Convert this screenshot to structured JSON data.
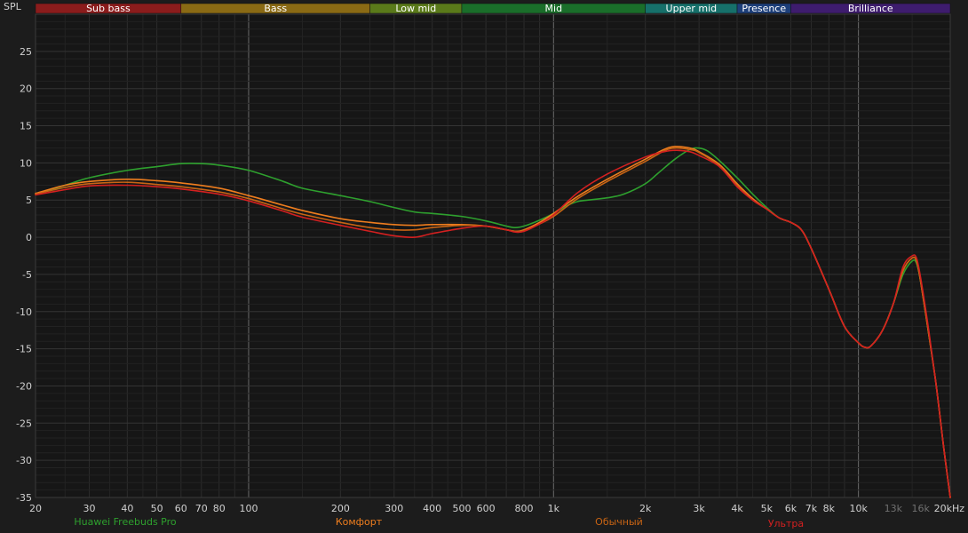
{
  "chart_data": {
    "type": "line",
    "ylabel": "SPL",
    "xscale": "log",
    "xlim": [
      20,
      20000
    ],
    "ylim": [
      -35,
      30
    ],
    "grid": true,
    "y_ticks": [
      25,
      20,
      15,
      10,
      5,
      0,
      -5,
      -10,
      -15,
      -20,
      -25,
      -30,
      -35
    ],
    "x_ticks": [
      {
        "v": 20,
        "label": "20",
        "dim": false
      },
      {
        "v": 30,
        "label": "30",
        "dim": false
      },
      {
        "v": 40,
        "label": "40",
        "dim": false
      },
      {
        "v": 50,
        "label": "50",
        "dim": false
      },
      {
        "v": 60,
        "label": "60",
        "dim": false
      },
      {
        "v": 70,
        "label": "70",
        "dim": false
      },
      {
        "v": 80,
        "label": "80",
        "dim": false
      },
      {
        "v": 100,
        "label": "100",
        "dim": false
      },
      {
        "v": 200,
        "label": "200",
        "dim": false
      },
      {
        "v": 300,
        "label": "300",
        "dim": false
      },
      {
        "v": 400,
        "label": "400",
        "dim": false
      },
      {
        "v": 500,
        "label": "500",
        "dim": false
      },
      {
        "v": 600,
        "label": "600",
        "dim": false
      },
      {
        "v": 800,
        "label": "800",
        "dim": false
      },
      {
        "v": 1000,
        "label": "1k",
        "dim": false
      },
      {
        "v": 2000,
        "label": "2k",
        "dim": false
      },
      {
        "v": 3000,
        "label": "3k",
        "dim": false
      },
      {
        "v": 4000,
        "label": "4k",
        "dim": false
      },
      {
        "v": 5000,
        "label": "5k",
        "dim": false
      },
      {
        "v": 6000,
        "label": "6k",
        "dim": false
      },
      {
        "v": 7000,
        "label": "7k",
        "dim": false
      },
      {
        "v": 8000,
        "label": "8k",
        "dim": false
      },
      {
        "v": 10000,
        "label": "10k",
        "dim": false
      },
      {
        "v": 13000,
        "label": "13k",
        "dim": true
      },
      {
        "v": 16000,
        "label": "16k",
        "dim": true
      },
      {
        "v": 20000,
        "label": "20kHz",
        "dim": false
      }
    ],
    "bands": [
      {
        "label": "Sub bass",
        "from": 20,
        "to": 60,
        "color": "#8b1c1c"
      },
      {
        "label": "Bass",
        "from": 60,
        "to": 250,
        "color": "#8a6a14"
      },
      {
        "label": "Low mid",
        "from": 250,
        "to": 500,
        "color": "#5a7a1a"
      },
      {
        "label": "Mid",
        "from": 500,
        "to": 2000,
        "color": "#1a6e2a"
      },
      {
        "label": "Upper mid",
        "from": 2000,
        "to": 4000,
        "color": "#16706a"
      },
      {
        "label": "Presence",
        "from": 4000,
        "to": 6000,
        "color": "#1d3f7a"
      },
      {
        "label": "Brilliance",
        "from": 6000,
        "to": 20000,
        "color": "#3e1c6e"
      }
    ],
    "series": [
      {
        "name": "Huawei Freebuds Pro",
        "color": "#2ea02e",
        "points": [
          [
            20,
            5.8
          ],
          [
            25,
            7.0
          ],
          [
            30,
            8.0
          ],
          [
            40,
            9.0
          ],
          [
            50,
            9.5
          ],
          [
            60,
            9.9
          ],
          [
            70,
            9.9
          ],
          [
            80,
            9.7
          ],
          [
            100,
            9.0
          ],
          [
            130,
            7.5
          ],
          [
            150,
            6.6
          ],
          [
            200,
            5.6
          ],
          [
            250,
            4.8
          ],
          [
            300,
            4.0
          ],
          [
            350,
            3.4
          ],
          [
            400,
            3.2
          ],
          [
            500,
            2.8
          ],
          [
            600,
            2.2
          ],
          [
            700,
            1.5
          ],
          [
            750,
            1.3
          ],
          [
            800,
            1.5
          ],
          [
            900,
            2.3
          ],
          [
            1000,
            3.2
          ],
          [
            1100,
            4.2
          ],
          [
            1200,
            4.8
          ],
          [
            1300,
            5.0
          ],
          [
            1500,
            5.3
          ],
          [
            1700,
            5.8
          ],
          [
            2000,
            7.2
          ],
          [
            2200,
            8.6
          ],
          [
            2500,
            10.5
          ],
          [
            2800,
            11.8
          ],
          [
            3000,
            12.0
          ],
          [
            3200,
            11.6
          ],
          [
            3500,
            10.3
          ],
          [
            4000,
            8.0
          ],
          [
            4500,
            5.8
          ],
          [
            5000,
            4.0
          ],
          [
            5500,
            2.6
          ],
          [
            6000,
            2.0
          ],
          [
            6500,
            1.0
          ],
          [
            7000,
            -1.5
          ],
          [
            8000,
            -7.0
          ],
          [
            9000,
            -12.0
          ],
          [
            10000,
            -14.2
          ],
          [
            10500,
            -14.8
          ],
          [
            11000,
            -14.6
          ],
          [
            12000,
            -12.5
          ],
          [
            13000,
            -9.0
          ],
          [
            14000,
            -5.0
          ],
          [
            15000,
            -3.2
          ],
          [
            15500,
            -3.5
          ],
          [
            16000,
            -6.0
          ],
          [
            17000,
            -13.0
          ],
          [
            18000,
            -20.0
          ],
          [
            19000,
            -28.0
          ],
          [
            20000,
            -35
          ]
        ]
      },
      {
        "name": "Комфорт",
        "color": "#ee7d1e",
        "points": [
          [
            20,
            5.9
          ],
          [
            25,
            7.0
          ],
          [
            30,
            7.5
          ],
          [
            40,
            7.8
          ],
          [
            50,
            7.6
          ],
          [
            60,
            7.3
          ],
          [
            80,
            6.6
          ],
          [
            100,
            5.6
          ],
          [
            130,
            4.3
          ],
          [
            150,
            3.6
          ],
          [
            200,
            2.5
          ],
          [
            250,
            2.0
          ],
          [
            300,
            1.7
          ],
          [
            350,
            1.6
          ],
          [
            400,
            1.7
          ],
          [
            500,
            1.7
          ],
          [
            600,
            1.5
          ],
          [
            700,
            1.0
          ],
          [
            750,
            0.8
          ],
          [
            800,
            1.0
          ],
          [
            900,
            2.0
          ],
          [
            1000,
            3.2
          ],
          [
            1200,
            5.5
          ],
          [
            1500,
            7.8
          ],
          [
            2000,
            10.5
          ],
          [
            2300,
            11.8
          ],
          [
            2500,
            12.2
          ],
          [
            2800,
            12.0
          ],
          [
            3000,
            11.5
          ],
          [
            3500,
            9.8
          ],
          [
            4000,
            7.2
          ],
          [
            4500,
            5.2
          ],
          [
            5000,
            3.8
          ],
          [
            5500,
            2.6
          ],
          [
            6000,
            2.0
          ],
          [
            6500,
            1.0
          ],
          [
            7000,
            -1.5
          ],
          [
            8000,
            -7.0
          ],
          [
            9000,
            -12.0
          ],
          [
            10000,
            -14.2
          ],
          [
            10500,
            -14.8
          ],
          [
            11000,
            -14.6
          ],
          [
            12000,
            -12.5
          ],
          [
            13000,
            -9.0
          ],
          [
            14000,
            -4.5
          ],
          [
            15000,
            -2.8
          ],
          [
            15500,
            -3.2
          ],
          [
            16000,
            -6.0
          ],
          [
            17000,
            -13.0
          ],
          [
            18000,
            -20.0
          ],
          [
            19000,
            -28.0
          ],
          [
            20000,
            -35
          ]
        ]
      },
      {
        "name": "Обычный",
        "color": "#c86414",
        "points": [
          [
            20,
            5.8
          ],
          [
            25,
            6.7
          ],
          [
            30,
            7.2
          ],
          [
            40,
            7.4
          ],
          [
            50,
            7.1
          ],
          [
            60,
            6.8
          ],
          [
            80,
            6.1
          ],
          [
            100,
            5.2
          ],
          [
            130,
            3.8
          ],
          [
            150,
            3.1
          ],
          [
            200,
            2.0
          ],
          [
            250,
            1.3
          ],
          [
            300,
            1.0
          ],
          [
            350,
            1.0
          ],
          [
            400,
            1.3
          ],
          [
            500,
            1.6
          ],
          [
            600,
            1.5
          ],
          [
            700,
            1.0
          ],
          [
            750,
            0.8
          ],
          [
            800,
            0.9
          ],
          [
            900,
            1.8
          ],
          [
            1000,
            2.8
          ],
          [
            1200,
            5.2
          ],
          [
            1500,
            7.5
          ],
          [
            2000,
            10.2
          ],
          [
            2300,
            11.6
          ],
          [
            2500,
            12.0
          ],
          [
            2800,
            11.8
          ],
          [
            3000,
            11.4
          ],
          [
            3500,
            9.6
          ],
          [
            4000,
            7.0
          ],
          [
            4500,
            5.0
          ],
          [
            5000,
            3.8
          ],
          [
            5500,
            2.6
          ],
          [
            6000,
            2.0
          ],
          [
            6500,
            1.0
          ],
          [
            7000,
            -1.5
          ],
          [
            8000,
            -7.0
          ],
          [
            9000,
            -12.0
          ],
          [
            10000,
            -14.2
          ],
          [
            10500,
            -14.8
          ],
          [
            11000,
            -14.6
          ],
          [
            12000,
            -12.5
          ],
          [
            13000,
            -9.0
          ],
          [
            14000,
            -4.5
          ],
          [
            15000,
            -2.8
          ],
          [
            15500,
            -3.2
          ],
          [
            16000,
            -6.0
          ],
          [
            17000,
            -13.0
          ],
          [
            18000,
            -20.0
          ],
          [
            19000,
            -28.0
          ],
          [
            20000,
            -35
          ]
        ]
      },
      {
        "name": "Ультра",
        "color": "#d42020",
        "points": [
          [
            20,
            5.7
          ],
          [
            25,
            6.4
          ],
          [
            30,
            6.9
          ],
          [
            40,
            7.0
          ],
          [
            50,
            6.8
          ],
          [
            60,
            6.5
          ],
          [
            80,
            5.8
          ],
          [
            100,
            4.9
          ],
          [
            130,
            3.5
          ],
          [
            150,
            2.7
          ],
          [
            200,
            1.6
          ],
          [
            250,
            0.8
          ],
          [
            300,
            0.2
          ],
          [
            350,
            0.0
          ],
          [
            400,
            0.5
          ],
          [
            500,
            1.2
          ],
          [
            600,
            1.5
          ],
          [
            700,
            1.0
          ],
          [
            750,
            0.7
          ],
          [
            800,
            0.8
          ],
          [
            900,
            1.8
          ],
          [
            1000,
            3.0
          ],
          [
            1200,
            6.0
          ],
          [
            1500,
            8.5
          ],
          [
            2000,
            10.8
          ],
          [
            2300,
            11.5
          ],
          [
            2500,
            11.7
          ],
          [
            2800,
            11.5
          ],
          [
            3000,
            11.0
          ],
          [
            3500,
            9.5
          ],
          [
            4000,
            6.8
          ],
          [
            4500,
            5.0
          ],
          [
            5000,
            3.8
          ],
          [
            5500,
            2.6
          ],
          [
            6000,
            2.0
          ],
          [
            6500,
            1.0
          ],
          [
            7000,
            -1.5
          ],
          [
            8000,
            -7.0
          ],
          [
            9000,
            -12.0
          ],
          [
            10000,
            -14.2
          ],
          [
            10500,
            -14.8
          ],
          [
            11000,
            -14.6
          ],
          [
            12000,
            -12.5
          ],
          [
            13000,
            -9.0
          ],
          [
            14000,
            -4.0
          ],
          [
            15000,
            -2.5
          ],
          [
            15500,
            -2.8
          ],
          [
            16000,
            -5.5
          ],
          [
            17000,
            -12.5
          ],
          [
            18000,
            -20.0
          ],
          [
            19000,
            -28.0
          ],
          [
            20000,
            -35
          ]
        ]
      }
    ]
  }
}
